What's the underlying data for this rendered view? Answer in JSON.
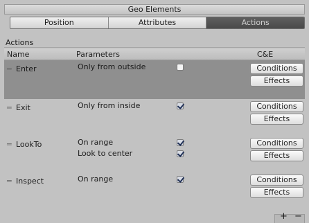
{
  "window": {
    "title": "Geo Elements"
  },
  "tabs": [
    {
      "label": "Position"
    },
    {
      "label": "Attributes"
    },
    {
      "label": "Actions"
    }
  ],
  "section": {
    "label": "Actions"
  },
  "table": {
    "headers": {
      "name": "Name",
      "parameters": "Parameters",
      "ce": "C&E"
    },
    "rows": [
      {
        "name": "Enter",
        "selected": true,
        "params": [
          {
            "label": "Only from outside",
            "checked": false
          }
        ],
        "buttons": [
          "Conditions",
          "Effects"
        ]
      },
      {
        "name": "Exit",
        "selected": false,
        "params": [
          {
            "label": "Only from inside",
            "checked": true
          }
        ],
        "buttons": [
          "Conditions",
          "Effects"
        ]
      },
      {
        "name": "LookTo",
        "selected": false,
        "params": [
          {
            "label": "On range",
            "checked": true
          },
          {
            "label": "Look to center",
            "checked": true
          }
        ],
        "buttons": [
          "Conditions",
          "Effects"
        ]
      },
      {
        "name": "Inspect",
        "selected": false,
        "params": [
          {
            "label": "On range",
            "checked": true
          }
        ],
        "buttons": [
          "Conditions",
          "Effects"
        ]
      }
    ]
  },
  "footer": {
    "add_label": "+",
    "remove_label": "−"
  },
  "icons": {
    "drag_handle": "drag-handle-icon",
    "checkbox": "checkbox-icon"
  },
  "colors": {
    "active_tab": "#4a4a4a",
    "selected_row": "#8f8f8f"
  }
}
